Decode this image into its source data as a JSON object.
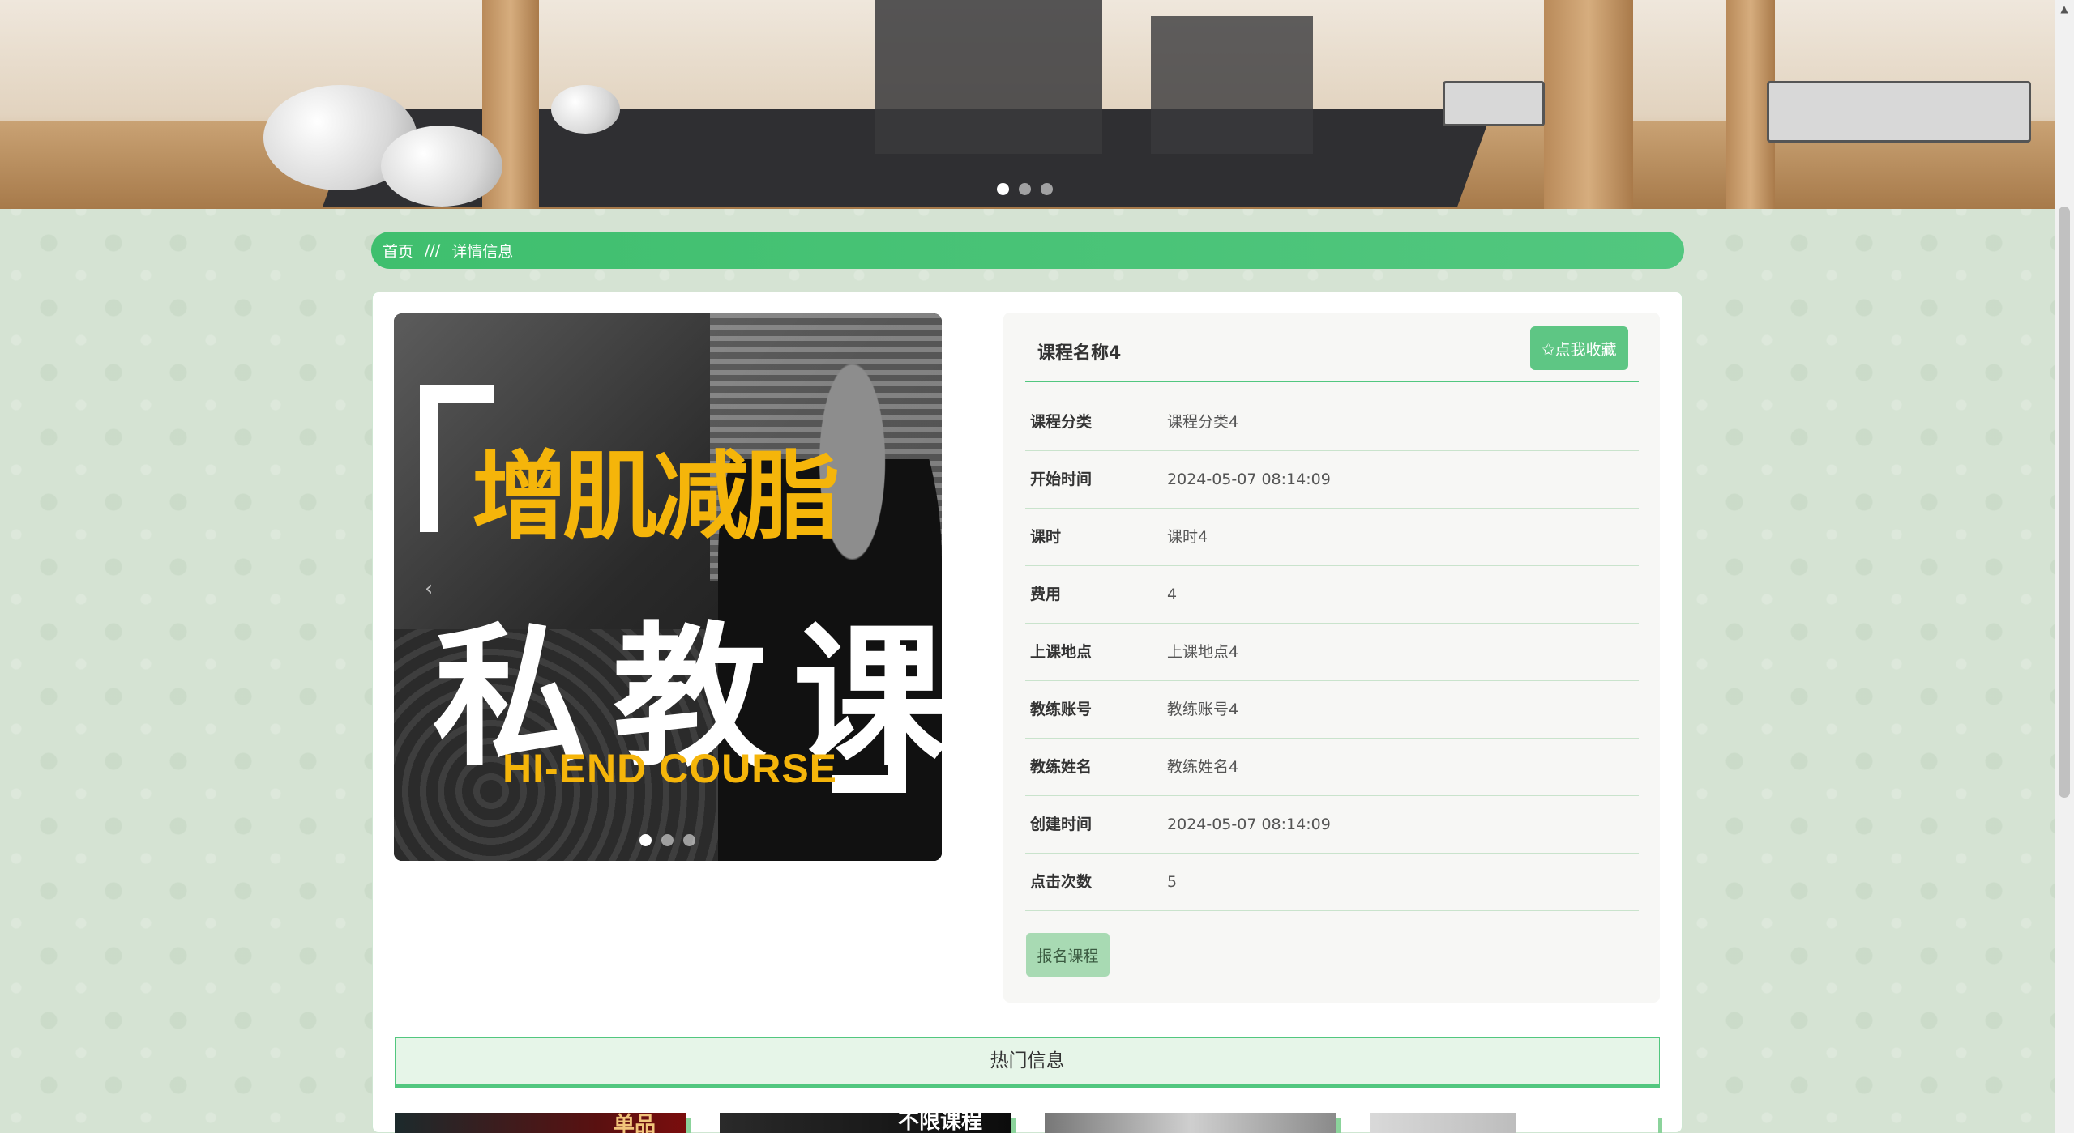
{
  "breadcrumb": {
    "home": "首页",
    "separator": "///",
    "current": "详情信息"
  },
  "course": {
    "name": "课程名称4",
    "favorite_label": "✩点我收藏",
    "enroll_label": "报名课程",
    "image_text": {
      "headline": "增肌减脂",
      "main": "私教课",
      "subtitle": "HI-END  COURSE"
    },
    "fields": [
      {
        "label": "课程分类",
        "value": "课程分类4"
      },
      {
        "label": "开始时间",
        "value": "2024-05-07 08:14:09"
      },
      {
        "label": "课时",
        "value": "课时4"
      },
      {
        "label": "费用",
        "value": "4"
      },
      {
        "label": "上课地点",
        "value": "上课地点4"
      },
      {
        "label": "教练账号",
        "value": "教练账号4"
      },
      {
        "label": "教练姓名",
        "value": "教练姓名4"
      },
      {
        "label": "创建时间",
        "value": "2024-05-07 08:14:09"
      },
      {
        "label": "点击次数",
        "value": "5"
      }
    ]
  },
  "hot": {
    "title": "热门信息",
    "thumb_texts": [
      "单品",
      "不限课程"
    ]
  },
  "carousel": {
    "slide_count": 3,
    "active_index": 0
  },
  "colors": {
    "accent": "#52c77f",
    "button": "#5ec684",
    "enroll": "#a8dab3",
    "gold": "#f5b50a"
  }
}
